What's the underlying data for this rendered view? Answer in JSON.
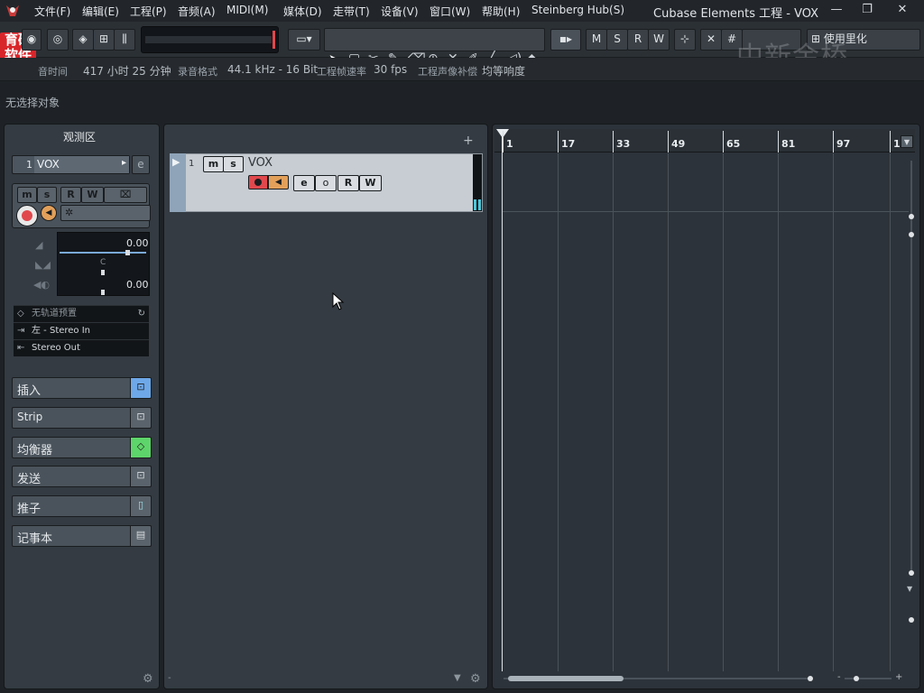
{
  "menu": [
    "文件(F)",
    "编辑(E)",
    "工程(P)",
    "音频(A)",
    "MIDI(M)",
    "媒体(D)",
    "走带(T)",
    "设备(V)",
    "窗口(W)",
    "帮助(H)",
    "Steinberg Hub(S)"
  ],
  "window_title": "Cubase Elements 工程 - VOX",
  "logo": {
    "line1": "育碟",
    "line2": "软件"
  },
  "watermark": "中新金桥",
  "window_controls": {
    "minimize": "—",
    "restore": "❐",
    "close": "✕"
  },
  "toolbar": {
    "transport_labels": [
      "M",
      "S",
      "R",
      "W"
    ],
    "grid_label": "使用里化",
    "hash": "#"
  },
  "status": {
    "record_time_label": "音时间",
    "record_time_value": "417 小时 25 分钟",
    "record_format_label": "录音格式",
    "record_format_value": "44.1 kHz - 16 Bit",
    "frame_rate_label": "工程帧速率",
    "frame_rate_value": "30 fps",
    "pan_law_label": "工程声像补偿",
    "pan_law_value": "均等响度"
  },
  "info_line": "无选择对象",
  "inspector": {
    "title": "观测区",
    "track_number": "1",
    "track_name": "VOX",
    "buttons": {
      "m": "m",
      "s": "s",
      "r": "R",
      "w": "W"
    },
    "volume_value": "0.00",
    "pan_value": "C",
    "delay_value": "0.00",
    "preset": "无轨道预置",
    "input": "左 - Stereo In",
    "output": "Stereo Out",
    "sections": [
      {
        "label": "插入",
        "icon": "⊡"
      },
      {
        "label": "Strip",
        "icon": "⊡"
      },
      {
        "label": "均衡器",
        "icon": "◇"
      },
      {
        "label": "发送",
        "icon": "⊡"
      },
      {
        "label": "推子",
        "icon": "▯"
      },
      {
        "label": "记事本",
        "icon": "▤"
      }
    ]
  },
  "tracklist": {
    "add": "+",
    "track_number": "1",
    "track_name": "VOX",
    "buttons": {
      "m": "m",
      "s": "s",
      "r": "R",
      "w": "W",
      "e": "e",
      "o": "o"
    }
  },
  "ruler": {
    "marks": [
      "1",
      "17",
      "33",
      "49",
      "65",
      "81",
      "97",
      "1"
    ]
  },
  "colors": {
    "record": "#e0484d",
    "monitor": "#e2a05a",
    "equalizer": "#5ed56a",
    "insert": "#6ea8e8"
  }
}
